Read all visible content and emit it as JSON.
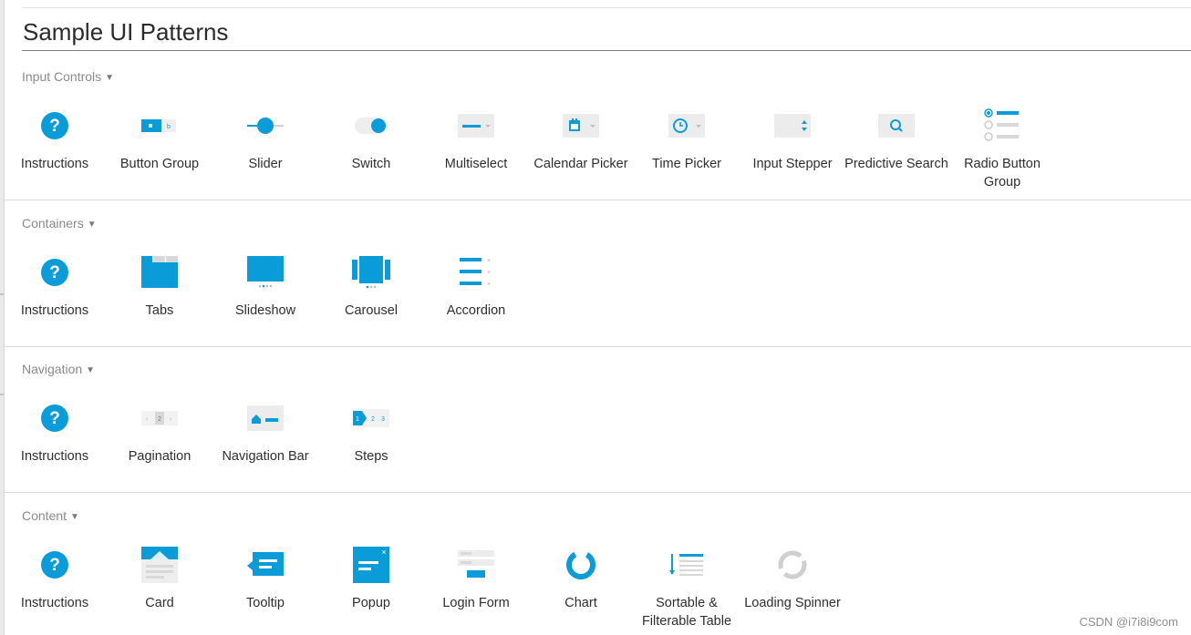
{
  "page": {
    "title": "Sample UI Patterns",
    "accent_color": "#0a9bd9",
    "muted_color": "#d8d8d8"
  },
  "sections": {
    "input_controls": {
      "label": "Input Controls",
      "items": [
        {
          "label": "Instructions",
          "icon": "question-circle-icon"
        },
        {
          "label": "Button Group",
          "icon": "button-group-icon"
        },
        {
          "label": "Slider",
          "icon": "slider-icon"
        },
        {
          "label": "Switch",
          "icon": "switch-icon"
        },
        {
          "label": "Multiselect",
          "icon": "multiselect-icon"
        },
        {
          "label": "Calendar Picker",
          "icon": "calendar-icon"
        },
        {
          "label": "Time Picker",
          "icon": "clock-icon"
        },
        {
          "label": "Input Stepper",
          "icon": "stepper-icon"
        },
        {
          "label": "Predictive Search",
          "icon": "search-icon"
        },
        {
          "label": "Radio Button Group",
          "icon": "radio-group-icon"
        }
      ]
    },
    "containers": {
      "label": "Containers",
      "items": [
        {
          "label": "Instructions",
          "icon": "question-circle-icon"
        },
        {
          "label": "Tabs",
          "icon": "tabs-icon"
        },
        {
          "label": "Slideshow",
          "icon": "slideshow-icon"
        },
        {
          "label": "Carousel",
          "icon": "carousel-icon"
        },
        {
          "label": "Accordion",
          "icon": "accordion-icon"
        }
      ]
    },
    "navigation": {
      "label": "Navigation",
      "items": [
        {
          "label": "Instructions",
          "icon": "question-circle-icon"
        },
        {
          "label": "Pagination",
          "icon": "pagination-icon"
        },
        {
          "label": "Navigation Bar",
          "icon": "navigation-bar-icon"
        },
        {
          "label": "Steps",
          "icon": "steps-icon"
        }
      ]
    },
    "content": {
      "label": "Content",
      "items": [
        {
          "label": "Instructions",
          "icon": "question-circle-icon"
        },
        {
          "label": "Card",
          "icon": "card-icon"
        },
        {
          "label": "Tooltip",
          "icon": "tooltip-icon"
        },
        {
          "label": "Popup",
          "icon": "popup-icon"
        },
        {
          "label": "Login Form",
          "icon": "login-form-icon"
        },
        {
          "label": "Chart",
          "icon": "donut-chart-icon"
        },
        {
          "label": "Sortable & Filterable Table",
          "icon": "sortable-table-icon"
        },
        {
          "label": "Loading Spinner",
          "icon": "spinner-icon"
        }
      ]
    }
  },
  "watermark": "CSDN @i7i8i9com"
}
